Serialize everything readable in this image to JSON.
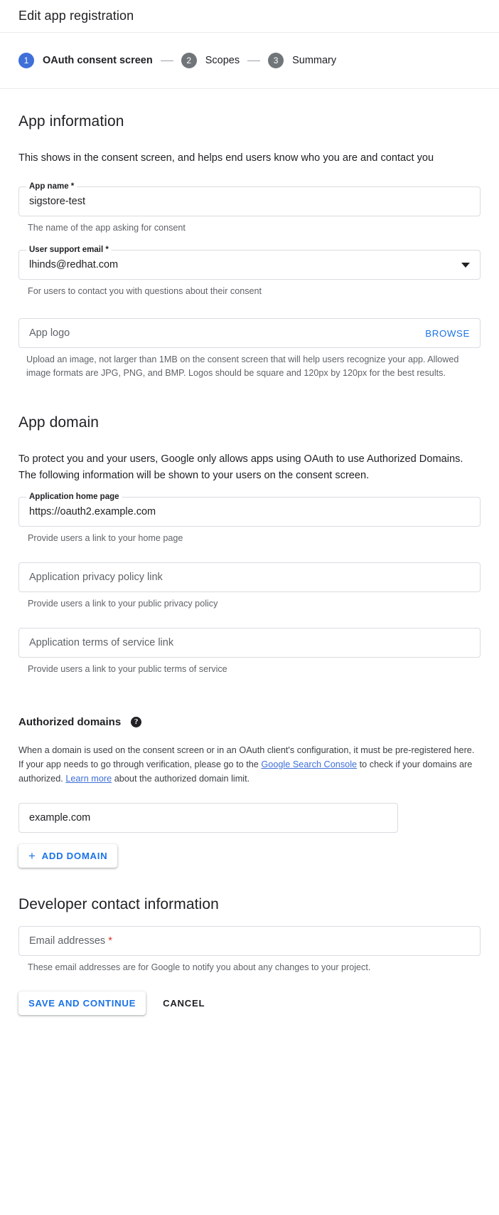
{
  "header": {
    "title": "Edit app registration"
  },
  "stepper": {
    "steps": [
      {
        "number": "1",
        "label": "OAuth consent screen",
        "state": "active"
      },
      {
        "number": "2",
        "label": "Scopes",
        "state": "inactive"
      },
      {
        "number": "3",
        "label": "Summary",
        "state": "inactive"
      }
    ]
  },
  "app_information": {
    "heading": "App information",
    "description": "This shows in the consent screen, and helps end users know who you are and contact you",
    "app_name": {
      "label": "App name",
      "required_mark": "*",
      "value": "sigstore-test",
      "hint": "The name of the app asking for consent"
    },
    "user_support_email": {
      "label": "User support email",
      "required_mark": "*",
      "value": "lhinds@redhat.com",
      "hint": "For users to contact you with questions about their consent"
    },
    "app_logo": {
      "placeholder": "App logo",
      "browse_label": "BROWSE",
      "hint": "Upload an image, not larger than 1MB on the consent screen that will help users recognize your app. Allowed image formats are JPG, PNG, and BMP. Logos should be square and 120px by 120px for the best results."
    }
  },
  "app_domain": {
    "heading": "App domain",
    "description": "To protect you and your users, Google only allows apps using OAuth to use Authorized Domains. The following information will be shown to your users on the consent screen.",
    "home_page": {
      "label": "Application home page",
      "value": "https://oauth2.example.com",
      "hint": "Provide users a link to your home page"
    },
    "privacy_policy": {
      "placeholder": "Application privacy policy link",
      "hint": "Provide users a link to your public privacy policy"
    },
    "terms_of_service": {
      "placeholder": "Application terms of service link",
      "hint": "Provide users a link to your public terms of service"
    }
  },
  "authorized_domains": {
    "heading": "Authorized domains",
    "help_icon": "help-icon",
    "paragraph_part1": "When a domain is used on the consent screen or in an OAuth client's configuration, it must be pre-registered here. If your app needs to go through verification, please go to the ",
    "link1": "Google Search Console",
    "paragraph_part2": " to check if your domains are authorized. ",
    "link2": "Learn more",
    "paragraph_part3": " about the authorized domain limit.",
    "domain_value": "example.com",
    "add_domain_label": "ADD DOMAIN",
    "add_domain_icon": "plus-icon"
  },
  "developer_contact": {
    "heading": "Developer contact information",
    "email_addresses": {
      "placeholder": "Email addresses",
      "required_mark": "*",
      "hint": "These email addresses are for Google to notify you about any changes to your project."
    }
  },
  "footer": {
    "save_label": "SAVE AND CONTINUE",
    "cancel_label": "CANCEL"
  },
  "colors": {
    "accent_blue": "#1a73e8",
    "step_active": "#3f6fd8",
    "step_inactive": "#70757a",
    "required_red": "#d93025",
    "link_blue": "#3f6fd8"
  }
}
